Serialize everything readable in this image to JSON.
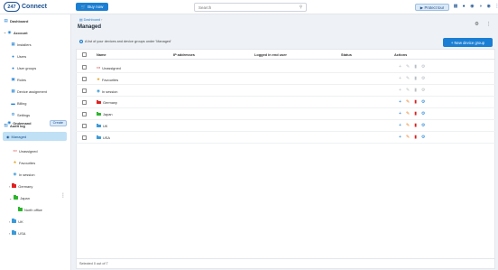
{
  "topbar": {
    "logo_badge": "247",
    "logo_text": "Connect",
    "buy_label": "Buy now",
    "search_placeholder": "Search",
    "tour_label": "Protect tour",
    "icons": [
      "chat-icon",
      "bell-icon",
      "help-icon",
      "theme-icon",
      "user-icon",
      "more-icon"
    ]
  },
  "sidebar": {
    "dashboard": "Dashboard",
    "account": "Account",
    "account_items": [
      "Installers",
      "Users",
      "User groups",
      "Roles",
      "Device assignment",
      "Billing",
      "Settings"
    ],
    "audit_log": "Audit log",
    "ondemand": "Ondemand",
    "create_label": "Create",
    "managed": "Managed",
    "groups": [
      {
        "label": "Unassigned",
        "icon": "unassigned-icon"
      },
      {
        "label": "Favourites",
        "icon": "star-icon"
      },
      {
        "label": "In session",
        "icon": "session-icon"
      },
      {
        "label": "Germany",
        "icon": "folder-red-icon"
      },
      {
        "label": "Japan",
        "icon": "folder-green-icon"
      },
      {
        "label": "North office",
        "icon": "folder-green-icon"
      },
      {
        "label": "UK",
        "icon": "folder-blue-icon"
      },
      {
        "label": "USA",
        "icon": "folder-blue-icon"
      }
    ]
  },
  "main": {
    "breadcrumb": "Dashboard",
    "title": "Managed",
    "info": "A list of your devices and device groups under 'Managed'",
    "new_group_label": "+ New device group",
    "columns": [
      "Name",
      "IP addresses",
      "Logged in end user",
      "Status",
      "Actions"
    ],
    "rows": [
      {
        "name": "Unassigned",
        "icon": "unassigned-icon",
        "active": false
      },
      {
        "name": "Favourites",
        "icon": "star-icon",
        "active": false
      },
      {
        "name": "In session",
        "icon": "session-icon",
        "active": false
      },
      {
        "name": "Germany",
        "icon": "folder-red-icon",
        "active": true
      },
      {
        "name": "Japan",
        "icon": "folder-green-icon",
        "active": true
      },
      {
        "name": "UK",
        "icon": "folder-blue-icon",
        "active": true
      },
      {
        "name": "USA",
        "icon": "folder-blue-icon",
        "active": true
      }
    ],
    "footer": "Selected 0 out of 7"
  },
  "colors": {
    "accent": "#1a7fd4",
    "brand": "#1a4f8f",
    "selected_bg": "#bfe0f5",
    "germany": "#e02020",
    "japan": "#2bb52b",
    "uk_usa": "#3a9ad8"
  }
}
